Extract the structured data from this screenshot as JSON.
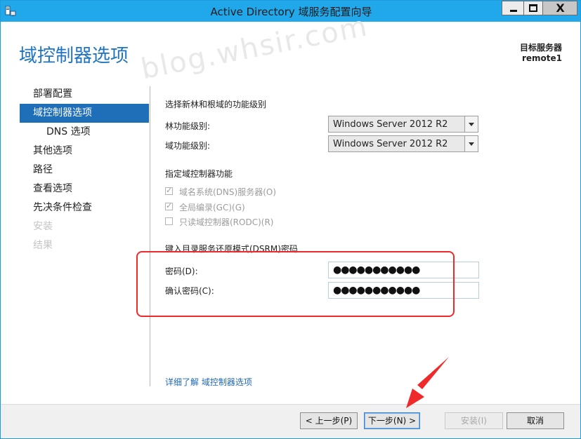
{
  "window": {
    "title": "Active Directory 域服务配置向导",
    "min_label": "",
    "close_label": "X"
  },
  "header": {
    "page_title": "域控制器选项",
    "target_server_label": "目标服务器",
    "target_server_name": "remote1",
    "watermark": "blog.whsir.com"
  },
  "nav": {
    "items": [
      {
        "label": "部署配置",
        "state": "normal"
      },
      {
        "label": "域控制器选项",
        "state": "selected"
      },
      {
        "label": "DNS 选项",
        "state": "sub"
      },
      {
        "label": "其他选项",
        "state": "normal"
      },
      {
        "label": "路径",
        "state": "normal"
      },
      {
        "label": "查看选项",
        "state": "normal"
      },
      {
        "label": "先决条件检查",
        "state": "normal"
      },
      {
        "label": "安装",
        "state": "disabled"
      },
      {
        "label": "结果",
        "state": "disabled"
      }
    ]
  },
  "content": {
    "functional_level_heading": "选择新林和根域的功能级别",
    "forest_level_label": "林功能级别:",
    "forest_level_value": "Windows Server 2012 R2",
    "domain_level_label": "域功能级别:",
    "domain_level_value": "Windows Server 2012 R2",
    "dc_capabilities_heading": "指定域控制器功能",
    "dns_server_label": "域名系统(DNS)服务器(O)",
    "dns_server_checked": true,
    "global_catalog_label": "全局编录(GC)(G)",
    "global_catalog_checked": true,
    "rodc_label": "只读域控制器(RODC)(R)",
    "rodc_checked": false,
    "checkmark_glyph": "✓",
    "dsrm_heading": "键入目录服务还原模式(DSRM)密码",
    "password_label": "密码(D):",
    "password_value": "●●●●●●●●●●●",
    "confirm_password_label": "确认密码(C):",
    "confirm_password_value": "●●●●●●●●●●●",
    "learn_more_link": "详细了解 域控制器选项"
  },
  "footer": {
    "prev_label": "< 上一步(P)",
    "next_label": "下一步(N) >",
    "install_label": "安装(I)",
    "cancel_label": "取消"
  },
  "colors": {
    "titlebar": "#20a8ea",
    "accent": "#1e6eb8",
    "page_title": "#1f74c1",
    "highlight_red": "#ef2a2a",
    "link": "#2269b8"
  }
}
